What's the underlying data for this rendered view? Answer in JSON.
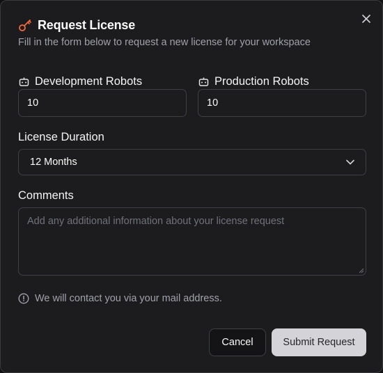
{
  "dialog": {
    "title": "Request License",
    "subtitle": "Fill in the form below to request a new license for your workspace",
    "icons": {
      "title_icon": "key-icon",
      "close_icon": "close-icon"
    }
  },
  "form": {
    "development_robots": {
      "label": "Development Robots",
      "icon": "robot-icon",
      "value": "10"
    },
    "production_robots": {
      "label": "Production Robots",
      "icon": "robot-icon",
      "value": "10"
    },
    "license_duration": {
      "label": "License Duration",
      "selected": "12 Months",
      "icon": "chevron-down-icon"
    },
    "comments": {
      "label": "Comments",
      "value": "",
      "placeholder": "Add any additional information about your license request"
    }
  },
  "notice": {
    "icon": "info-icon",
    "text": "We will contact you via your mail address."
  },
  "actions": {
    "cancel_label": "Cancel",
    "submit_label": "Submit Request"
  },
  "colors": {
    "background": "#1c1c1f",
    "accent_icon": "#f26b3a",
    "border": "#3f3f46",
    "submit_bg": "#d4d4d8"
  }
}
